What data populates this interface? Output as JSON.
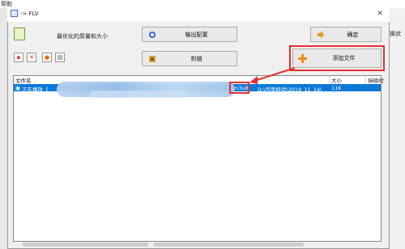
{
  "background": {
    "help_menu": "帮助",
    "right_label": "转换状"
  },
  "dialog": {
    "title": "-> FLV",
    "quality_label": "最优化的质量和大小",
    "buttons": {
      "output_settings": "输出配置",
      "confirm": "确定",
      "edit": "剪辑",
      "add_file": "添加文件"
    }
  },
  "file_list": {
    "columns": [
      "文件名",
      "大小",
      "持续时"
    ],
    "rows": [
      {
        "name_visible": "正在播放《 ",
        "name_tail": "m3u8",
        "path": "D:\\百度经验\\2019_11_14\\",
        "size": "11K",
        "duration": ""
      }
    ]
  },
  "colors": {
    "accent_selection": "#0a78d7",
    "annotation_red": "#e53131"
  }
}
